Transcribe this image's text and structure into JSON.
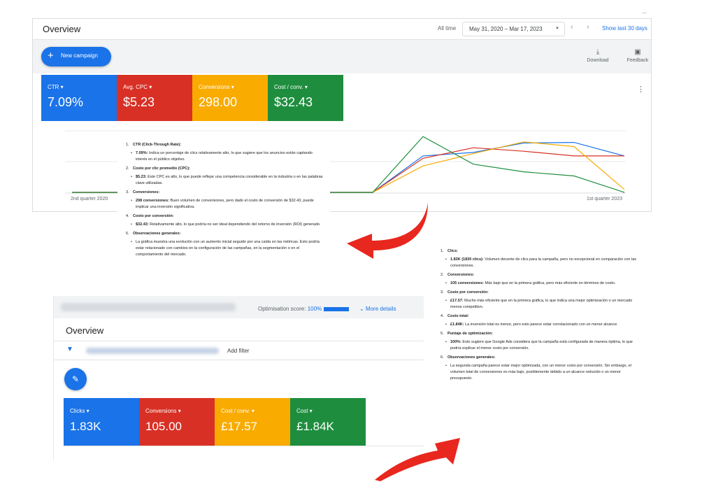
{
  "top_dots": "...",
  "screenshot1": {
    "title": "Overview",
    "all_time": "All time",
    "date_range": "May 31, 2020 – Mar 17, 2023",
    "show_last": "Show last 30 days",
    "new_campaign": "New campaign",
    "download": "Download",
    "feedback": "Feedback",
    "kpis": [
      {
        "label": "CTR",
        "value": "7.09%",
        "color": "#1a73e8"
      },
      {
        "label": "Avg. CPC",
        "value": "$5.23",
        "color": "#d93025"
      },
      {
        "label": "Conversions",
        "value": "298.00",
        "color": "#f9ab00"
      },
      {
        "label": "Cost / conv.",
        "value": "$32.43",
        "color": "#1e8e3e"
      }
    ],
    "x_start": "2nd quarter 2020",
    "x_end": "1st quarter 2023"
  },
  "chart_data": {
    "type": "line",
    "xlabel": "",
    "ylabel": "",
    "x": [
      "2nd quarter 2020",
      "",
      "",
      "",
      "",
      "",
      "",
      "",
      "",
      "",
      "",
      "1st quarter 2023"
    ],
    "series": [
      {
        "color": "#1a73e8",
        "values": [
          0,
          0,
          0,
          0,
          0,
          0,
          0,
          0.62,
          0.68,
          0.84,
          0.85,
          0.62
        ]
      },
      {
        "color": "#d93025",
        "values": [
          0,
          0,
          0,
          0,
          0,
          0,
          0,
          0.58,
          0.76,
          0.7,
          0.62,
          0.62
        ]
      },
      {
        "color": "#f9ab00",
        "values": [
          0,
          0,
          0,
          0,
          0,
          0,
          0,
          0.45,
          0.66,
          0.86,
          0.78,
          0.05
        ]
      },
      {
        "color": "#1e8e3e",
        "values": [
          0,
          0,
          0,
          0,
          0,
          0,
          0,
          0.95,
          0.48,
          0.35,
          0.28,
          0.0
        ]
      }
    ]
  },
  "note1": [
    {
      "n": "1.",
      "h": "CTR (Click-Through Rate):",
      "b": [
        {
          "k": "7.09%:",
          "t": " Indica un porcentaje de clics relativamente alto, lo que sugiere que los anuncios están captando interés en el público objetivo."
        }
      ]
    },
    {
      "n": "2.",
      "h": "Costo por clic promedio (CPC):",
      "b": [
        {
          "k": "$5.23:",
          "t": " Este CPC es alto, lo que puede reflejar una competencia considerable en la industria o en las palabras clave utilizadas."
        }
      ]
    },
    {
      "n": "3.",
      "h": "Conversiones:",
      "b": [
        {
          "k": "298 conversiones:",
          "t": " Buen volumen de conversiones, pero dado el costo de conversión de $32.43, puede implicar una inversión significativa."
        }
      ]
    },
    {
      "n": "4.",
      "h": "Costo por conversión:",
      "b": [
        {
          "k": "$32.43:",
          "t": " Relativamente alto, lo que podría no ser ideal dependiendo del retorno de inversión (ROI) generado."
        }
      ]
    },
    {
      "n": "5.",
      "h": "Observaciones generales:",
      "b": [
        {
          "k": "",
          "t": "La gráfica muestra una evolución con un aumento inicial seguido por una caída en las métricas. Esto podría estar relacionado con cambios en la configuración de las campañas, en la segmentación o en el comportamiento del mercado."
        }
      ]
    }
  ],
  "screenshot2": {
    "optimisation_label": "Optimisation score:",
    "optimisation_value": "100%",
    "more_details": "More details",
    "title": "Overview",
    "add_filter": "Add filter",
    "kpis": [
      {
        "label": "Clicks",
        "value": "1.83K",
        "color": "#1a73e8"
      },
      {
        "label": "Conversions",
        "value": "105.00",
        "color": "#d93025"
      },
      {
        "label": "Cost / conv.",
        "value": "£17.57",
        "color": "#f9ab00"
      },
      {
        "label": "Cost",
        "value": "£1.84K",
        "color": "#1e8e3e"
      }
    ]
  },
  "note2": [
    {
      "n": "1.",
      "h": "Clics:",
      "b": [
        {
          "k": "1.83K (1830 clics):",
          "t": " Volumen decente de clics para la campaña, pero no excepcional en comparación con las conversiones."
        }
      ]
    },
    {
      "n": "2.",
      "h": "Conversiones:",
      "b": [
        {
          "k": "105 conversiones:",
          "t": " Más bajo que en la primera gráfica, pero más eficiente en términos de costo."
        }
      ]
    },
    {
      "n": "3.",
      "h": "Costo por conversión:",
      "b": [
        {
          "k": "£17.57:",
          "t": " Mucho más eficiente que en la primera gráfica, lo que indica una mejor optimización o un mercado menos competitivo."
        }
      ]
    },
    {
      "n": "4.",
      "h": "Costo total:",
      "b": [
        {
          "k": "£1.84K:",
          "t": " La inversión total es menor, pero esto parece estar correlacionado con un menor alcance."
        }
      ]
    },
    {
      "n": "5.",
      "h": "Puntaje de optimización:",
      "b": [
        {
          "k": "100%:",
          "t": " Esto sugiere que Google Ads considera que la campaña está configurada de manera óptima, lo que podría explicar el menor costo por conversión."
        }
      ]
    },
    {
      "n": "6.",
      "h": "Observaciones generales:",
      "b": [
        {
          "k": "",
          "t": "La segunda campaña parece estar mejor optimizada, con un menor costo por conversión. Sin embargo, el volumen total de conversiones es más bajo, posiblemente debido a un alcance reducido o un menor presupuesto."
        }
      ]
    }
  ]
}
